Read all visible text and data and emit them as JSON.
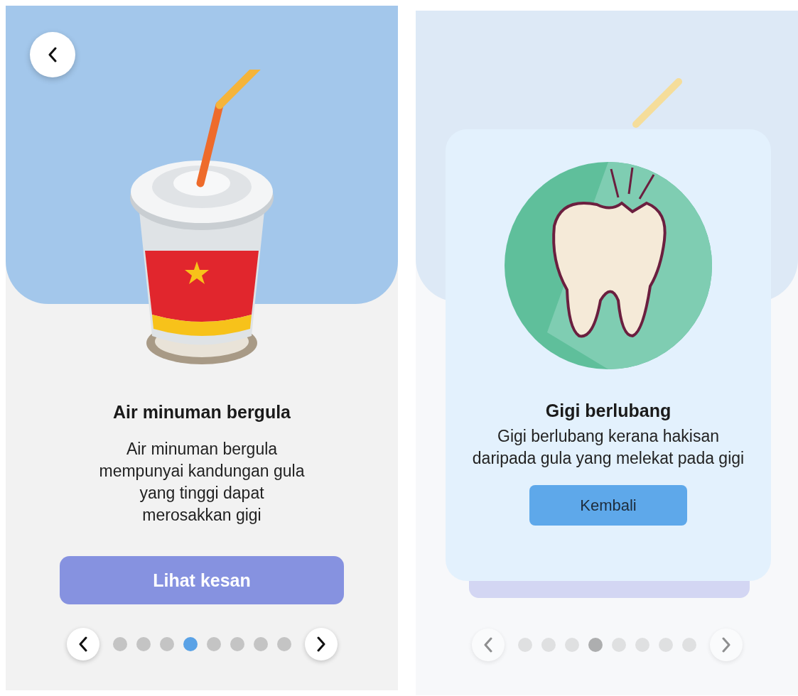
{
  "screens": [
    {
      "kind": "info",
      "title": "Air minuman bergula",
      "description": "Air minuman bergula mempunyai kandungan gula yang tinggi dapat merosakkan gigi",
      "button": "Lihat kesan",
      "pagination": [
        {
          "selected": false
        },
        {
          "selected": false
        },
        {
          "selected": false
        },
        {
          "selected": true
        },
        {
          "selected": false
        },
        {
          "selected": false
        },
        {
          "selected": false
        },
        {
          "selected": false
        }
      ]
    },
    {
      "kind": "modal",
      "title": "Gigi berlubang",
      "description": "Gigi berlubang kerana hakisan daripada gula yang melekat pada gigi",
      "button": "Kembali",
      "pagination": [
        {
          "selected": false
        },
        {
          "selected": false
        },
        {
          "selected": false
        },
        {
          "selected": true
        },
        {
          "selected": false
        },
        {
          "selected": false
        },
        {
          "selected": false
        },
        {
          "selected": false
        }
      ]
    }
  ]
}
